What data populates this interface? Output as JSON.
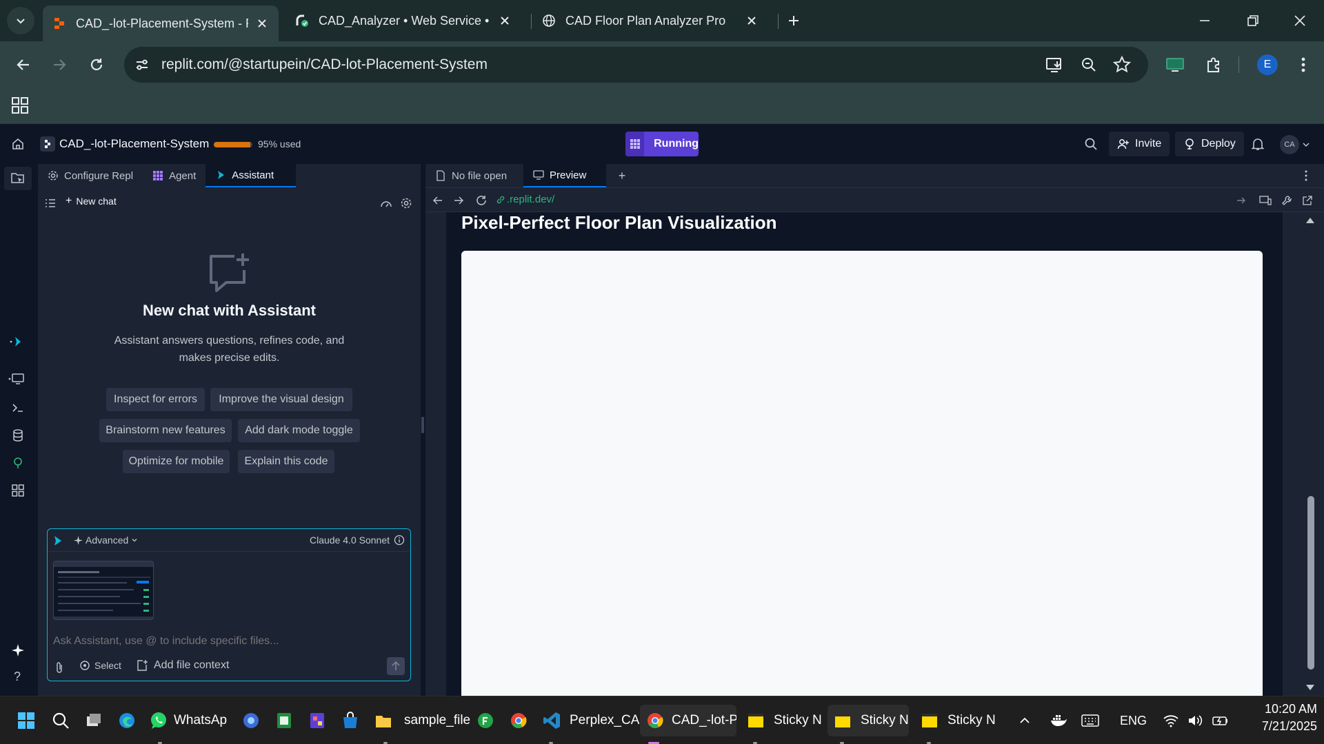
{
  "browser": {
    "tabs": [
      {
        "title": "CAD_-lot-Placement-System - R",
        "active": true
      },
      {
        "title": "CAD_Analyzer • Web Service • I",
        "active": false
      },
      {
        "title": "CAD Floor Plan Analyzer Pro",
        "active": false
      }
    ],
    "url": "replit.com/@startupein/CAD-lot-Placement-System",
    "profile_initial": "E"
  },
  "replit": {
    "repl_name": "CAD_-lot-Placement-System",
    "usage_label": "95% used",
    "usage_fraction": 0.95,
    "run_status": "Running",
    "invite_label": "Invite",
    "deploy_label": "Deploy",
    "avatar_initials": "CA",
    "left_tabs": [
      "Configure Repl",
      "Agent",
      "Assistant"
    ],
    "new_chat_label": "New chat",
    "empty_title": "New chat with Assistant",
    "empty_desc_line1": "Assistant answers questions, refines code, and",
    "empty_desc_line2": "makes precise edits.",
    "suggestions": [
      "Inspect for errors",
      "Improve the visual design",
      "Brainstorm new features",
      "Add dark mode toggle",
      "Optimize for mobile",
      "Explain this code"
    ],
    "composer": {
      "mode_label": "Advanced",
      "model_label": "Claude 4.0 Sonnet",
      "placeholder": "Ask Assistant, use @ to include specific files...",
      "select_label": "Select",
      "add_context_label": "Add file context"
    },
    "right_tabs": [
      "No file open",
      "Preview"
    ],
    "preview_url": ".replit.dev/",
    "preview_heading": "Pixel-Perfect Floor Plan Visualization"
  },
  "taskbar": {
    "apps": [
      "WhatsAp",
      "sample_file",
      "Perplex_CA",
      "CAD_-lot-P",
      "Sticky N",
      "Sticky N",
      "Sticky N"
    ],
    "language": "ENG",
    "time": "10:20 AM",
    "date": "7/21/2025"
  },
  "colors": {
    "accent": "#0079f2",
    "running": "#5b3fd6",
    "usage_bar": "#d9730d",
    "chrome_dark": "#1c2b2c",
    "chrome_light": "#2f4344"
  }
}
